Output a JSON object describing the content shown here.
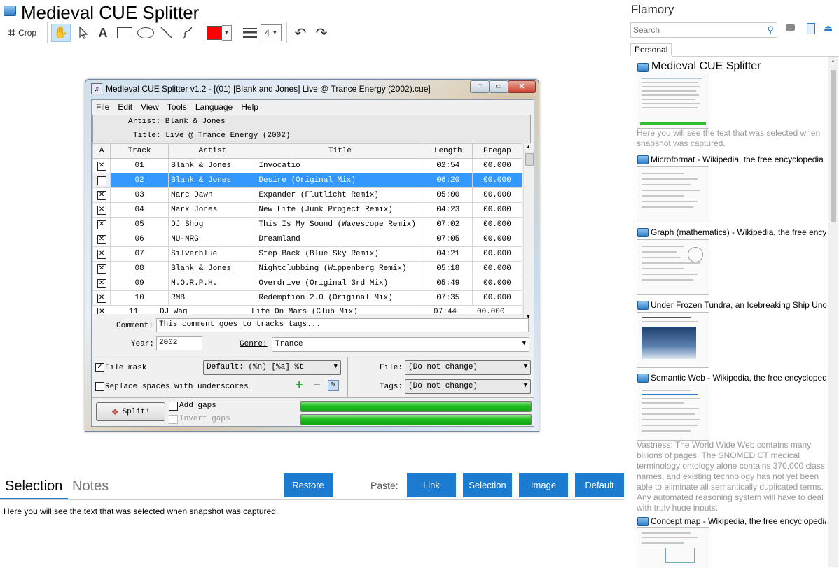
{
  "header": {
    "title": "Medieval CUE Splitter",
    "crop_label": "Crop",
    "line_width_value": "4",
    "color": "#ff0000"
  },
  "window": {
    "title": "Medieval CUE Splitter v1.2 - [(01) [Blank and Jones] Live @ Trance Energy (2002).cue]",
    "menu": [
      "File",
      "Edit",
      "View",
      "Tools",
      "Language",
      "Help"
    ],
    "artist_line": "Artist: Blank & Jones",
    "title_line": "Title: Live @ Trance Energy (2002)",
    "columns": [
      "A",
      "Track",
      "Artist",
      "Title",
      "Length",
      "Pregap"
    ],
    "rows": [
      {
        "track": "01",
        "artist": "Blank & Jones",
        "title": "Invocatio",
        "length": "02:54",
        "pregap": "00.000"
      },
      {
        "track": "02",
        "artist": "Blank & Jones",
        "title": "Desire (Original Mix)",
        "length": "06:20",
        "pregap": "00.000"
      },
      {
        "track": "03",
        "artist": "Marc Dawn",
        "title": "Expander (Flutlicht Remix)",
        "length": "05:00",
        "pregap": "00.000"
      },
      {
        "track": "04",
        "artist": "Mark Jones",
        "title": "New Life (Junk Project Remix)",
        "length": "04:23",
        "pregap": "00.000"
      },
      {
        "track": "05",
        "artist": "DJ Shog",
        "title": "This Is My Sound (Wavescope Remix)",
        "length": "07:02",
        "pregap": "00.000"
      },
      {
        "track": "06",
        "artist": "NU-NRG",
        "title": "Dreamland",
        "length": "07:05",
        "pregap": "00.000"
      },
      {
        "track": "07",
        "artist": "Silverblue",
        "title": "Step Back (Blue Sky Remix)",
        "length": "04:21",
        "pregap": "00.000"
      },
      {
        "track": "08",
        "artist": "Blank & Jones",
        "title": "Nightclubbing (Wippenberg Remix)",
        "length": "05:18",
        "pregap": "00.000"
      },
      {
        "track": "09",
        "artist": "M.O.R.P.H.",
        "title": "Overdrive (Original 3rd Mix)",
        "length": "05:49",
        "pregap": "00.000"
      },
      {
        "track": "10",
        "artist": "RMB",
        "title": "Redemption 2.0 (Original Mix)",
        "length": "07:35",
        "pregap": "00.000"
      },
      {
        "track": "11",
        "artist": "DJ Wag",
        "title": "Life On Mars (Club Mix)",
        "length": "07:44",
        "pregap": "00.000"
      }
    ],
    "comment_label": "Comment:",
    "comment_value": "This comment goes to tracks tags...",
    "year_label": "Year:",
    "year_value": "2002",
    "genre_label": "Genre:",
    "genre_value": "Trance",
    "file_mask_label": "File mask",
    "file_mask_value": "Default: (%n) [%a] %t",
    "replace_spaces_label": "Replace spaces with underscores",
    "file_label": "File:",
    "file_value": "(Do not change)",
    "tags_label": "Tags:",
    "tags_value": "(Do not change)",
    "split_label": "Split!",
    "add_gaps_label": "Add gaps",
    "invert_gaps_label": "Invert gaps"
  },
  "bottom": {
    "tab_selection": "Selection",
    "tab_notes": "Notes",
    "restore_label": "Restore",
    "paste_label": "Paste:",
    "link_label": "Link",
    "selection_label": "Selection",
    "image_label": "Image",
    "default_label": "Default",
    "selection_text": "Here you will see the text that was selected when snapshot was captured."
  },
  "right": {
    "app_name": "Flamory",
    "search_placeholder": "Search",
    "tab_personal": "Personal",
    "items": [
      {
        "title": "Medieval CUE Splitter",
        "desc": "Here you will see the text that was selected when snapshot was captured."
      },
      {
        "title": "Microformat - Wikipedia, the free encyclopedia"
      },
      {
        "title": "Graph (mathematics) - Wikipedia, the free encyc"
      },
      {
        "title": "Under Frozen Tundra, an Icebreaking Ship Unco"
      },
      {
        "title": "Semantic Web - Wikipedia, the free encyclopedia",
        "desc": "Vastness: The World Wide Web contains many billions of pages. The SNOMED CT medical terminology ontology alone contains 370,000 class names, and existing technology has not yet been able to eliminate all semantically duplicated terms. Any automated reasoning system will have to deal with truly huge inputs."
      },
      {
        "title": "Concept map - Wikipedia, the free encyclopedia"
      }
    ]
  }
}
